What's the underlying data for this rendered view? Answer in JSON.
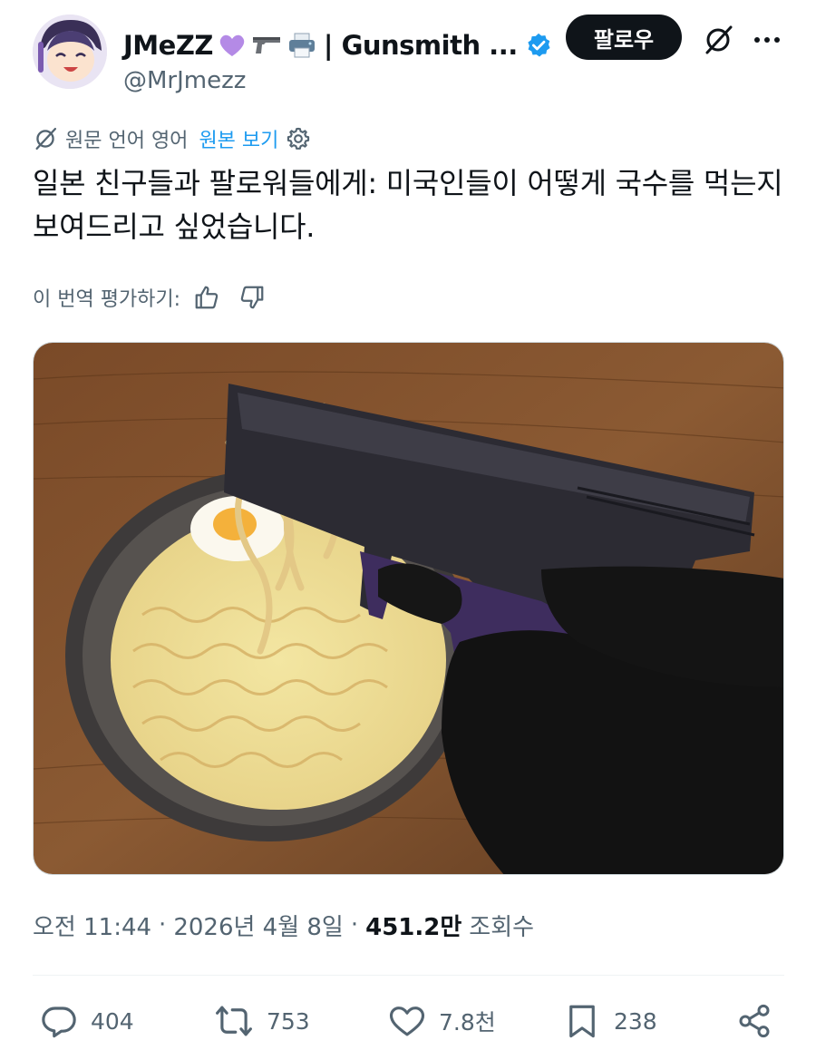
{
  "author": {
    "display_name": "JMeZZ",
    "name_suffix": "| Gunsmith ...",
    "handle": "@MrJmezz",
    "emoji": [
      "purple-heart",
      "pistol",
      "printer"
    ]
  },
  "follow_label": "팔로우",
  "translation": {
    "note": "원문 언어 영어",
    "show_original": "원본 보기"
  },
  "tweet_text": "일본 친구들과 팔로워들에게: 미국인들이 어떻게 국수를 먹는지 보여드리고 싶었습니다.",
  "rate_translation": "이 번역 평가하기:",
  "meta": {
    "time": "오전 11:44",
    "date": "2026년 4월 8일",
    "views_count": "451.2만",
    "views_label": "조회수"
  },
  "actions": {
    "replies": "404",
    "reposts": "753",
    "likes": "7.8천",
    "bookmarks": "238"
  },
  "colors": {
    "text": "#0f1419",
    "secondary": "#536471",
    "link": "#1d9bf0",
    "verified": "#1d9bf0",
    "follow_bg": "#0f1419"
  },
  "icons": [
    "grok-icon",
    "more-icon",
    "settings-icon",
    "thumbs-up-icon",
    "thumbs-down-icon",
    "reply-icon",
    "repost-icon",
    "like-icon",
    "bookmark-icon",
    "share-icon",
    "verified-badge-icon"
  ]
}
